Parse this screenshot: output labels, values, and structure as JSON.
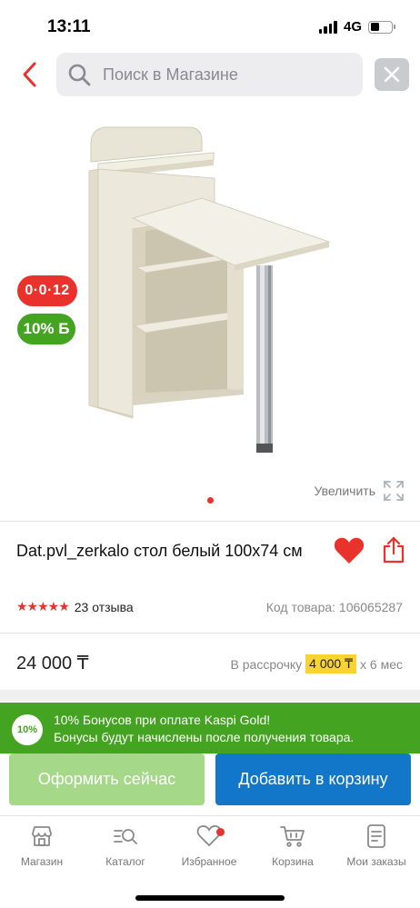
{
  "status_bar": {
    "time": "13:11",
    "network": "4G",
    "battery_level": 0.45
  },
  "search": {
    "placeholder": "Поиск в Магазине",
    "back_icon": "chevron-left-icon",
    "search_icon": "magnifier-icon",
    "clear_icon": "close-icon"
  },
  "gallery": {
    "installment_badge": "0·0·12",
    "bonus_badge": "10% Б",
    "zoom_label": "Увеличить",
    "zoom_icon": "expand-icon",
    "image_count": 1,
    "active_index": 1
  },
  "product": {
    "title": "Dat.pvl_zerkalo стол белый 100x74 см",
    "rating": 5,
    "reviews": "23 отзыва",
    "sku": "Код товара: 106065287",
    "price": "24 000 ₸",
    "installment_prefix": "В рассрочку",
    "installment_amount": "4 000 ₸",
    "installment_suffix": "х 6 мес",
    "favorite_icon": "heart-icon",
    "share_icon": "share-icon"
  },
  "promo": {
    "circle": "10%",
    "line1": "10% Бонусов при оплате Kaspi Gold!",
    "line2": "Бонусы будут начислены после получения товара."
  },
  "actions": {
    "buy_now": "Оформить сейчас",
    "add_to_cart": "Добавить в корзину"
  },
  "tabs": [
    {
      "label": "Магазин",
      "icon": "shop-icon"
    },
    {
      "label": "Каталог",
      "icon": "catalog-icon"
    },
    {
      "label": "Избранное",
      "icon": "heart-outline-icon"
    },
    {
      "label": "Корзина",
      "icon": "cart-icon"
    },
    {
      "label": "Мои заказы",
      "icon": "orders-icon"
    }
  ],
  "colors": {
    "accent_red": "#e8322b",
    "kaspi_green": "#44a320",
    "cart_blue": "#1277c9",
    "buy_green_light": "#a6d88a",
    "installment_yellow": "#f7d433"
  }
}
